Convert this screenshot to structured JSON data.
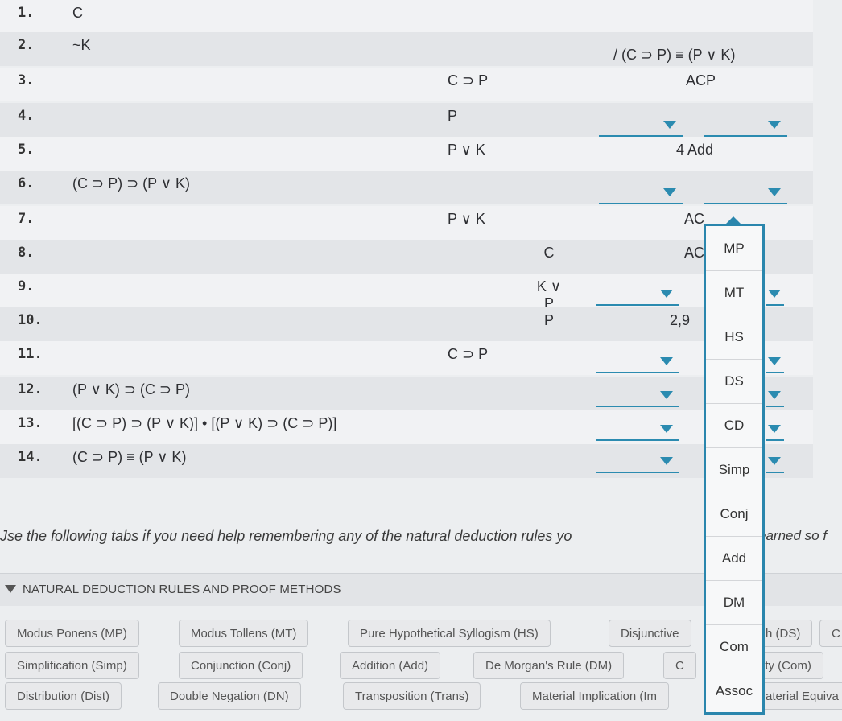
{
  "premise_conclusion": "/ (C ⊃ P) ≡ (P ∨ K)",
  "lines": [
    {
      "num": "1.",
      "main": "C",
      "mid": "",
      "mid2": "",
      "just": ""
    },
    {
      "num": "2.",
      "main": "~K",
      "mid": "",
      "mid2": "",
      "just": ""
    },
    {
      "num": "3.",
      "main": "",
      "mid": "C ⊃ P",
      "mid2": "",
      "just": "ACP"
    },
    {
      "num": "4.",
      "main": "",
      "mid": "P",
      "mid2": "",
      "just": ""
    },
    {
      "num": "5.",
      "main": "",
      "mid": "P ∨ K",
      "mid2": "",
      "just": "4 Add"
    },
    {
      "num": "6.",
      "main": "(C ⊃ P) ⊃ (P ∨ K)",
      "mid": "",
      "mid2": "",
      "just": ""
    },
    {
      "num": "7.",
      "main": "",
      "mid": "P ∨ K",
      "mid2": "",
      "just": "AC"
    },
    {
      "num": "8.",
      "main": "",
      "mid": "",
      "mid2": "C",
      "just": "AC"
    },
    {
      "num": "9.",
      "main": "",
      "mid": "",
      "mid2": "K ∨ P",
      "just": ""
    },
    {
      "num": "10.",
      "main": "",
      "mid": "",
      "mid2": "P",
      "just": "2,9"
    },
    {
      "num": "11.",
      "main": "",
      "mid": "C ⊃ P",
      "mid2": "",
      "just": ""
    },
    {
      "num": "12.",
      "main": "(P ∨ K) ⊃ (C ⊃ P)",
      "mid": "",
      "mid2": "",
      "just": ""
    },
    {
      "num": "13.",
      "main": "[(C ⊃ P) ⊃ (P ∨ K)] • [(P ∨ K) ⊃ (C ⊃ P)]",
      "mid": "",
      "mid2": "",
      "just": ""
    },
    {
      "num": "14.",
      "main": "(C ⊃ P) ≡ (P ∨ K)",
      "mid": "",
      "mid2": "",
      "just": ""
    }
  ],
  "help_text": "Jse the following tabs if you need help remembering any of the natural deduction rules yo",
  "help_text_tail": "earned so f",
  "section_title": "NATURAL DEDUCTION RULES AND PROOF METHODS",
  "tabs_row1": [
    "Modus Ponens (MP)",
    "Modus Tollens (MT)",
    "Pure Hypothetical Syllogism (HS)",
    "Disjunctive",
    "h (DS)",
    "C"
  ],
  "tabs_row2": [
    "Simplification (Simp)",
    "Conjunction (Conj)",
    "Addition (Add)",
    "De Morgan's Rule (DM)",
    "C",
    "ity (Com)"
  ],
  "tabs_row3": [
    "Distribution (Dist)",
    "Double Negation (DN)",
    "Transposition (Trans)",
    "Material Implication (Im",
    "aterial Equiva"
  ],
  "rule_options": [
    "MP",
    "MT",
    "HS",
    "DS",
    "CD",
    "Simp",
    "Conj",
    "Add",
    "DM",
    "Com",
    "Assoc"
  ],
  "icons": {
    "dropdown": "chevron-down-icon",
    "section_toggle": "triangle-down-icon"
  },
  "colors": {
    "accent": "#2a86ad"
  }
}
